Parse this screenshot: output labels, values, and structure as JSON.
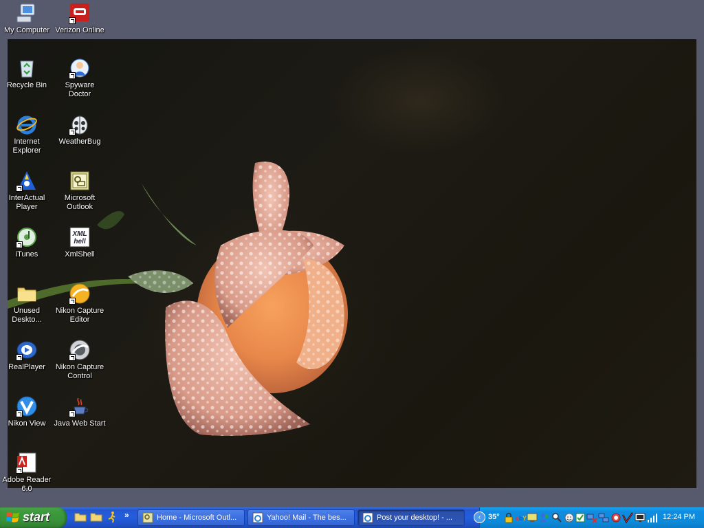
{
  "desktop": {
    "icons": [
      {
        "id": "my-computer",
        "label": "My Computer"
      },
      {
        "id": "verizon-online",
        "label": "Verizon Online"
      },
      {
        "id": "recycle-bin",
        "label": "Recycle Bin"
      },
      {
        "id": "spyware-doctor",
        "label": "Spyware Doctor"
      },
      {
        "id": "internet-explorer",
        "label": "Internet Explorer"
      },
      {
        "id": "weatherbug",
        "label": "WeatherBug"
      },
      {
        "id": "interactual-player",
        "label": "InterActual Player"
      },
      {
        "id": "microsoft-outlook",
        "label": "Microsoft Outlook"
      },
      {
        "id": "itunes",
        "label": "iTunes"
      },
      {
        "id": "xmlshell",
        "label": "XmlShell"
      },
      {
        "id": "unused-desktop",
        "label": "Unused Deskto..."
      },
      {
        "id": "nikon-capture-editor",
        "label": "Nikon Capture Editor"
      },
      {
        "id": "realplayer",
        "label": "RealPlayer"
      },
      {
        "id": "nikon-capture-control",
        "label": "Nikon Capture Control"
      },
      {
        "id": "nikon-view",
        "label": "Nikon View"
      },
      {
        "id": "java-web-start",
        "label": "Java Web Start"
      },
      {
        "id": "adobe-reader",
        "label": "Adobe Reader 6.0"
      }
    ]
  },
  "taskbar": {
    "start_label": "start",
    "quick_launch": [
      "folder-icon",
      "folder-icon",
      "aim-runner-icon"
    ],
    "overflow_label": "»",
    "tasks": [
      {
        "label": "Home - Microsoft Outl...",
        "icon": "outlook-icon"
      },
      {
        "label": "Yahoo! Mail - The bes...",
        "icon": "ie-icon"
      },
      {
        "label": "Post your desktop! - ...",
        "icon": "ie-icon"
      }
    ],
    "tray": {
      "chevron_label": "‹",
      "temperature": "35°",
      "clock": "12:24 PM"
    }
  },
  "colors": {
    "desktop_bg": "#57596d",
    "taskbar_blue": "#245ddb",
    "start_green": "#3a933a",
    "tray_blue": "#0d8ad9"
  }
}
